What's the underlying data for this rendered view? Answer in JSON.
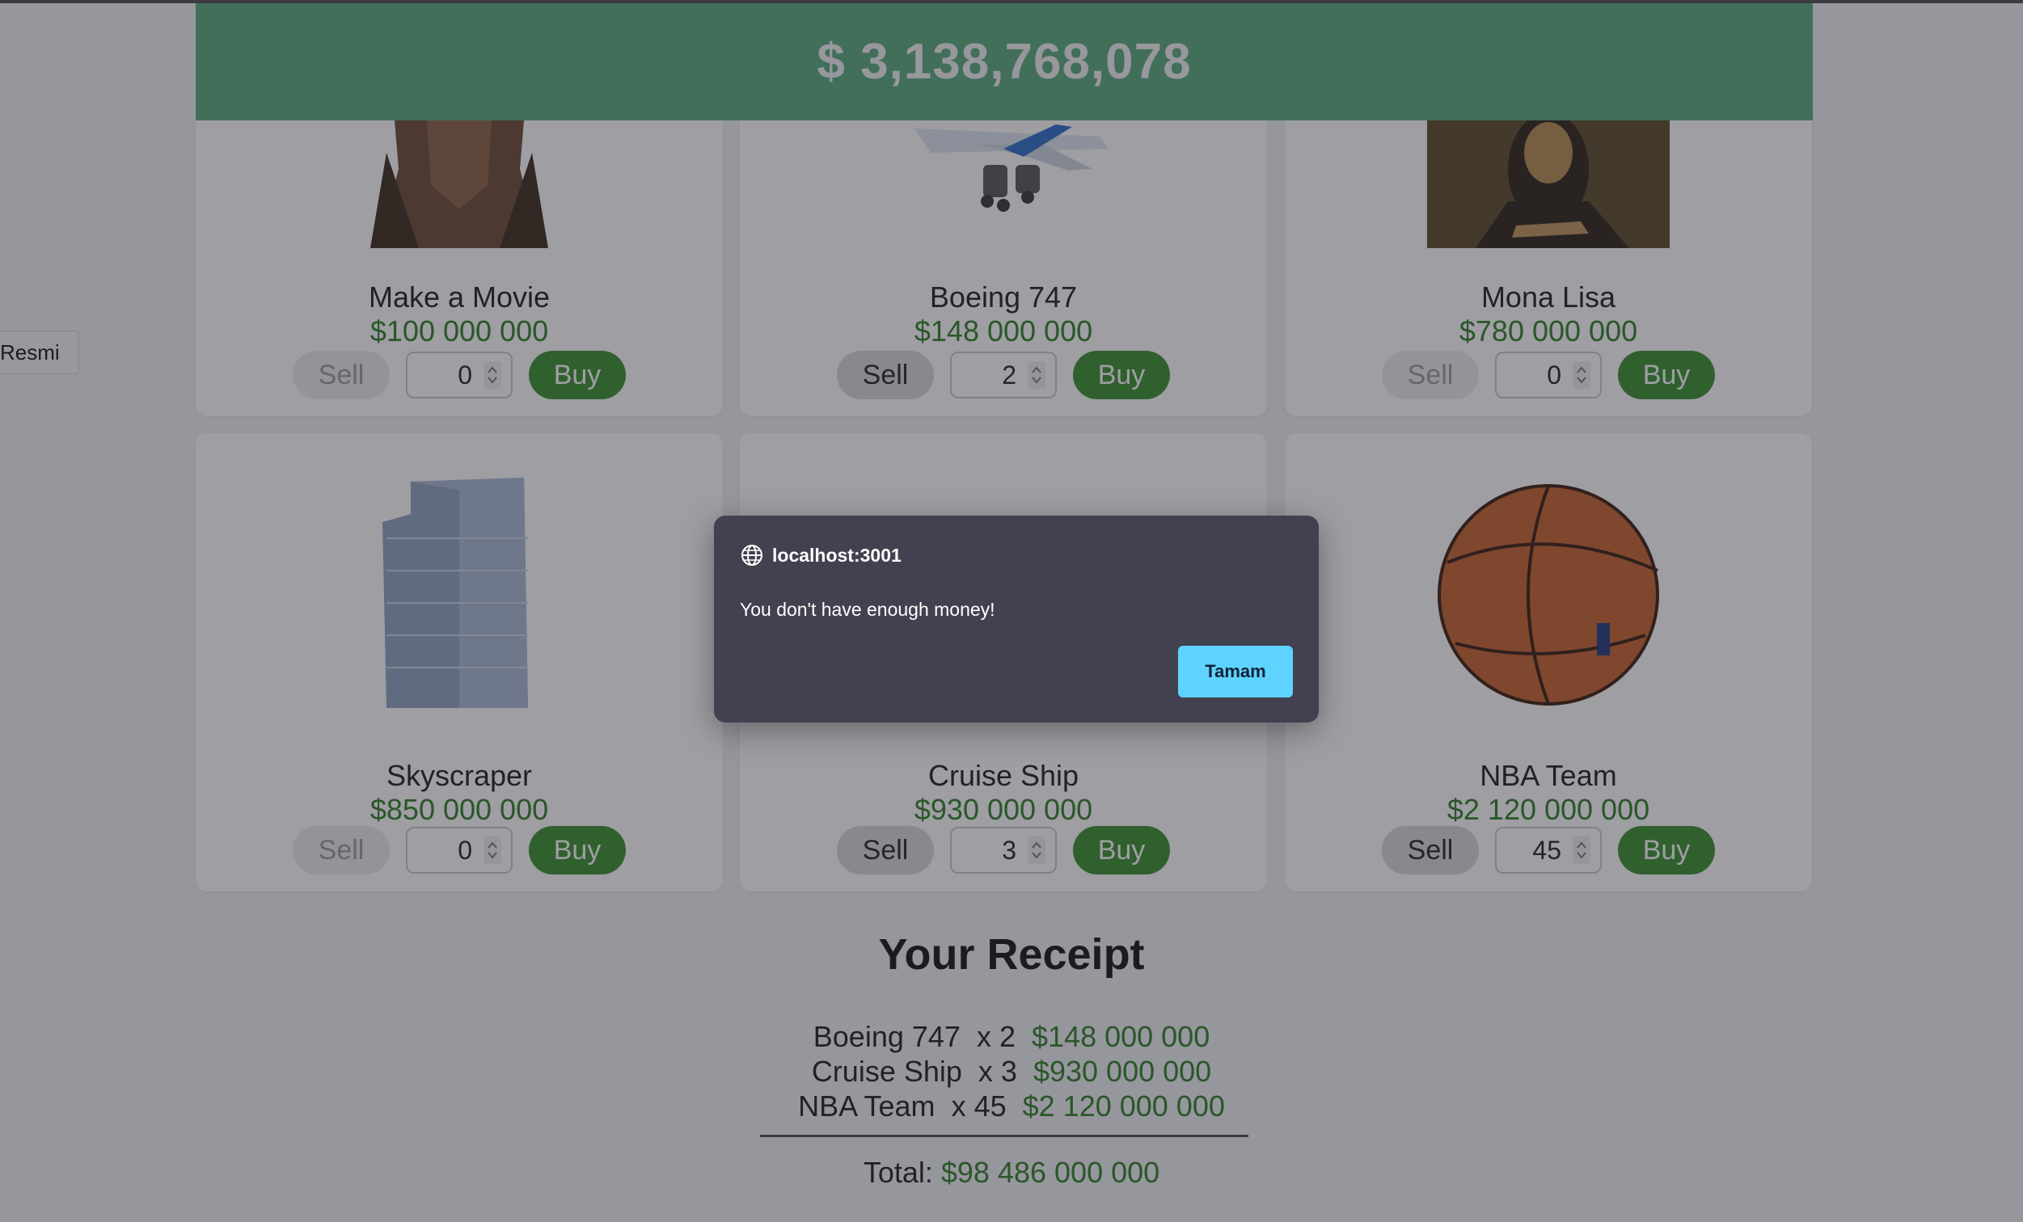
{
  "balance": "$ 3,138,768,078",
  "side_button": "Resmi",
  "products": [
    {
      "name": "Make a Movie",
      "price": "$100 000 000",
      "qty": "0",
      "sell": "Sell",
      "buy": "Buy"
    },
    {
      "name": "Boeing 747",
      "price": "$148 000 000",
      "qty": "2",
      "sell": "Sell",
      "buy": "Buy"
    },
    {
      "name": "Mona Lisa",
      "price": "$780 000 000",
      "qty": "0",
      "sell": "Sell",
      "buy": "Buy"
    },
    {
      "name": "Skyscraper",
      "price": "$850 000 000",
      "qty": "0",
      "sell": "Sell",
      "buy": "Buy"
    },
    {
      "name": "Cruise Ship",
      "price": "$930 000 000",
      "qty": "3",
      "sell": "Sell",
      "buy": "Buy"
    },
    {
      "name": "NBA Team",
      "price": "$2 120 000 000",
      "qty": "45",
      "sell": "Sell",
      "buy": "Buy"
    }
  ],
  "receipt": {
    "title": "Your Receipt",
    "items": [
      {
        "name": "Boeing 747",
        "qty": "x 2",
        "amount": "$148 000 000"
      },
      {
        "name": "Cruise Ship",
        "qty": "x 3",
        "amount": "$930 000 000"
      },
      {
        "name": "NBA Team",
        "qty": "x 45",
        "amount": "$2 120 000 000"
      }
    ],
    "total_label": "Total:",
    "total_amount": "$98 486 000 000"
  },
  "dialog": {
    "origin": "localhost:3001",
    "message": "You don't have enough money!",
    "ok": "Tamam"
  },
  "colors": {
    "banner": "#56a97a",
    "price": "#2e7d22",
    "buy_button": "#3a8e2c",
    "dialog_bg": "#424150",
    "dialog_ok": "#5fd3ff"
  }
}
